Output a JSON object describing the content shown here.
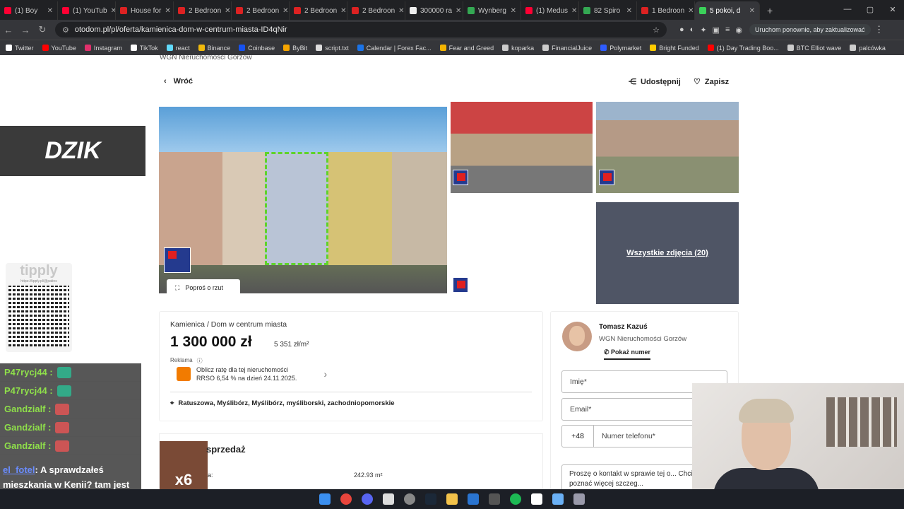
{
  "tabs": [
    {
      "label": "(1) Boy",
      "color": "#ff0033"
    },
    {
      "label": "(1) YouTub",
      "color": "#ff0033"
    },
    {
      "label": "House for",
      "color": "#d22"
    },
    {
      "label": "2 Bedroon",
      "color": "#d22"
    },
    {
      "label": "2 Bedroon",
      "color": "#d22"
    },
    {
      "label": "2 Bedroon",
      "color": "#d22"
    },
    {
      "label": "2 Bedroon",
      "color": "#d22"
    },
    {
      "label": "300000 ra",
      "color": "#eee"
    },
    {
      "label": "Wynberg",
      "color": "#34a853"
    },
    {
      "label": "(1) Medus",
      "color": "#ff0033"
    },
    {
      "label": "82 Spiro",
      "color": "#34a853"
    },
    {
      "label": "1 Bedroon",
      "color": "#d22"
    },
    {
      "label": "5 pokoi, d",
      "color": "#3bd15a",
      "active": true
    }
  ],
  "address": {
    "url": "otodom.pl/pl/oferta/kamienica-dom-w-centrum-miasta-ID4qNir",
    "relaunch": "Uruchom ponownie, aby zaktualizować"
  },
  "bookmarks": [
    {
      "label": "Twitter",
      "color": "#fff"
    },
    {
      "label": "YouTube",
      "color": "#f00"
    },
    {
      "label": "Instagram",
      "color": "#e1306c"
    },
    {
      "label": "TikTok",
      "color": "#fff"
    },
    {
      "label": "react",
      "color": "#61dafb"
    },
    {
      "label": "Binance",
      "color": "#f0b90b"
    },
    {
      "label": "Coinbase",
      "color": "#1652f0"
    },
    {
      "label": "ByBit",
      "color": "#f7a600"
    },
    {
      "label": "script.txt",
      "color": "#ddd"
    },
    {
      "label": "Calendar | Forex Fac...",
      "color": "#1a73e8"
    },
    {
      "label": "Fear and Greed",
      "color": "#f4b400"
    },
    {
      "label": "koparka",
      "color": "#ccc"
    },
    {
      "label": "FinancialJuice",
      "color": "#ccc"
    },
    {
      "label": "Polymarket",
      "color": "#2e5cff"
    },
    {
      "label": "Bright Funded",
      "color": "#ffcc00"
    },
    {
      "label": "(1) Day Trading Boo...",
      "color": "#f00"
    },
    {
      "label": "BTC Elliot wave",
      "color": "#ccc"
    },
    {
      "label": "palcówka",
      "color": "#ccc"
    }
  ],
  "page": {
    "crumb": "WGN Nieruchomości Gorzów",
    "back": "Wróć",
    "share": "Udostępnij",
    "save": "Zapisz",
    "plan_button": "Poproś o rzut",
    "all_photos": "Wszystkie zdjęcia (20)",
    "property_type": "Kamienica / Dom w centrum miasta",
    "price": "1 300 000 zł",
    "price_per_m2": "5 351 zł/m²",
    "reklama": "Reklama",
    "ad_line1": "Oblicz ratę dla tej nieruchomości",
    "ad_line2": "RRSO 6,54 % na dzień 24.11.2025.",
    "address": "Ratuszowa, Myślibórz, Myślibórz, myśliborski, zachodniopomorskie",
    "section_title": "sprzedaż",
    "area_value": "242.93 m²",
    "area_colon": "a:"
  },
  "agent": {
    "name": "Tomasz Kazuś",
    "agency": "WGN Nieruchomości Gorzów",
    "show_number": "Pokaż numer",
    "first_name_ph": "Imię*",
    "email_ph": "Email*",
    "phone_prefix": "+48",
    "phone_ph": "Numer telefonu*",
    "message": "Proszę o kontakt w sprawie tej o... Chciałbym poznać więcej szczeg..."
  },
  "overlay": {
    "dzik": "DZIK",
    "tipply": "tipply",
    "tipply_url": "https://tipply.pl/@patins",
    "chat": [
      {
        "user": "P47rycj44 :",
        "emote": "#3a8"
      },
      {
        "user": "P47rycj44 :",
        "emote": "#3a8"
      },
      {
        "user": "Gandzialf :",
        "emote": "#c55"
      },
      {
        "user": "Gandzialf :",
        "emote": "#c55"
      },
      {
        "user": "Gandzialf :",
        "emote": "#c55"
      }
    ],
    "chat_user": "el_fotel",
    "chat_message": ": A sprawdzałeś mieszkania w Kenii? tam jest bezpieczniej",
    "x6": "x6"
  }
}
